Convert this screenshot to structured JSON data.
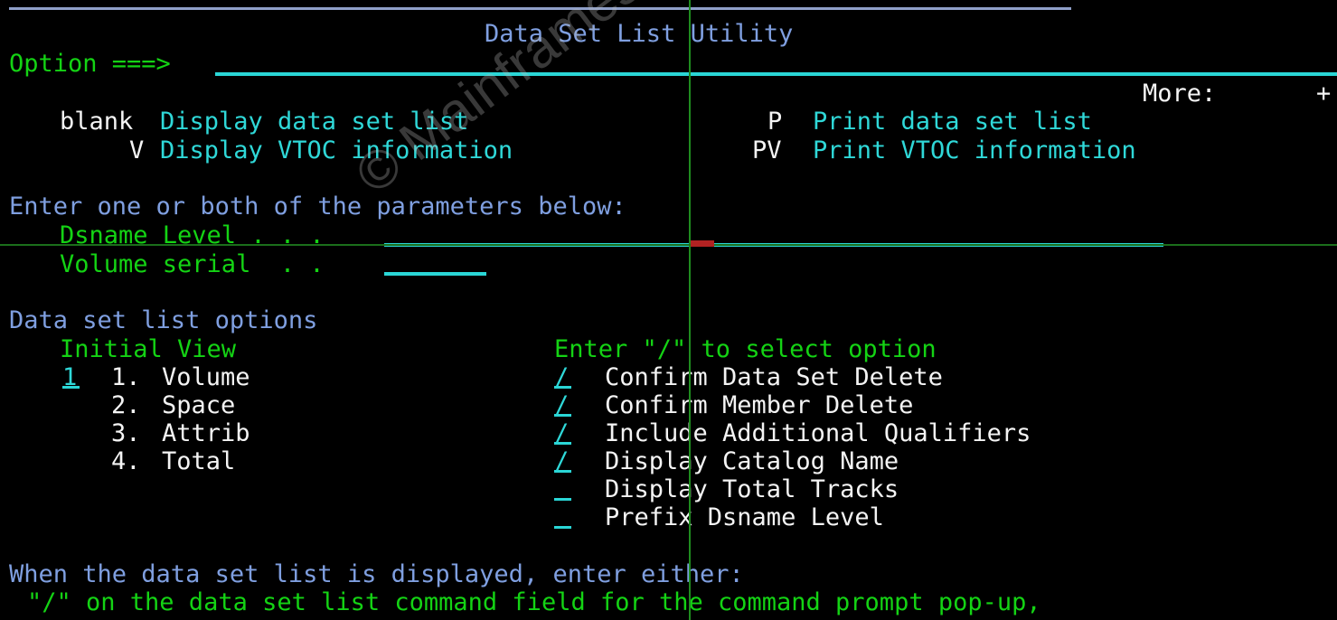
{
  "screen": {
    "title": "Data Set List Utility",
    "more_label": "More:",
    "more_indicator": "+",
    "watermark": "© Mainframestechhelp"
  },
  "command": {
    "label": "Option ===>",
    "value": "",
    "placeholder": ""
  },
  "primary_options": {
    "left": [
      {
        "code": "blank",
        "description": "Display data set list"
      },
      {
        "code": "V",
        "description": "Display VTOC information"
      }
    ],
    "right": [
      {
        "code": "P",
        "description": "Print data set list"
      },
      {
        "code": "PV",
        "description": "Print VTOC information"
      }
    ]
  },
  "parameters": {
    "instruction": "Enter one or both of the parameters below:",
    "fields": [
      {
        "label": "Dsname Level . . .",
        "value": ""
      },
      {
        "label": "Volume serial  . .",
        "value": ""
      }
    ]
  },
  "options_section": {
    "heading": "Data set list options",
    "initial_view": {
      "heading": "Initial View",
      "selected": "1",
      "choices": [
        {
          "number": "1.",
          "label": "Volume"
        },
        {
          "number": "2.",
          "label": "Space"
        },
        {
          "number": "3.",
          "label": "Attrib"
        },
        {
          "number": "4.",
          "label": "Total"
        }
      ]
    },
    "select_options": {
      "heading": "Enter \"/\" to select option",
      "items": [
        {
          "mark": "/",
          "label": "Confirm Data Set Delete"
        },
        {
          "mark": "/",
          "label": "Confirm Member Delete"
        },
        {
          "mark": "/",
          "label": "Include Additional Qualifiers"
        },
        {
          "mark": "/",
          "label": "Display Catalog Name"
        },
        {
          "mark": "_",
          "label": "Display Total Tracks"
        },
        {
          "mark": "_",
          "label": "Prefix Dsname Level"
        }
      ]
    }
  },
  "footer": {
    "line1": "When the data set list is displayed, enter either:",
    "line2": "\"/\" on the data set list command field for the command prompt pop-up,"
  },
  "colors": {
    "background": "#000000",
    "green": "#14d314",
    "cyan": "#2fd8d8",
    "white": "#f4f4f4",
    "blue": "#7f9fe0",
    "rule_top": "#8f9fc8",
    "cursor": "#b22222",
    "crosshair": "#1f8c1f"
  }
}
